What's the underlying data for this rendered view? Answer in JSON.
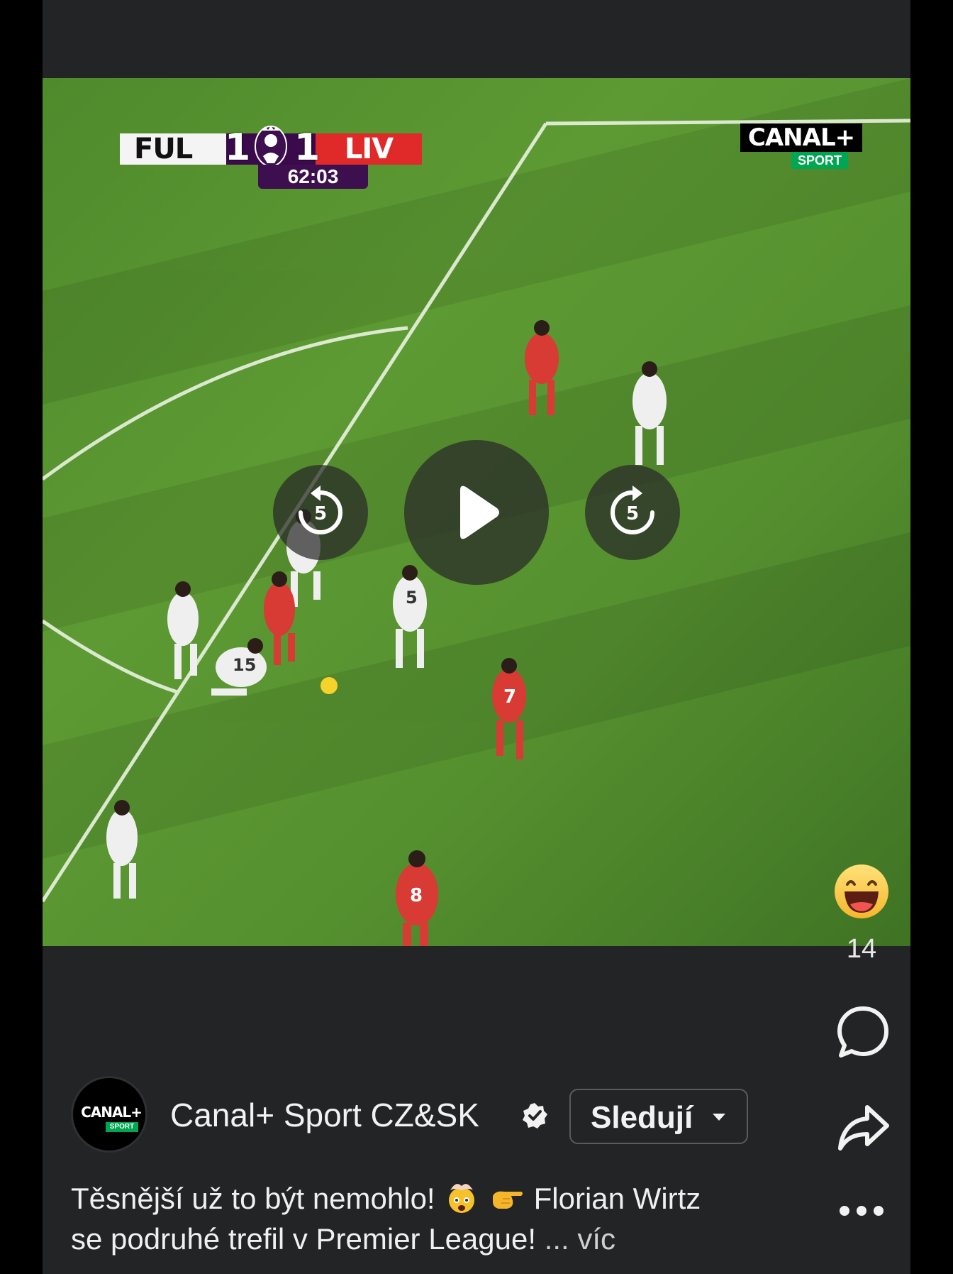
{
  "video": {
    "scoreboard": {
      "home_team": "FUL",
      "home_score": "1",
      "away_score": "1",
      "away_team": "LIV",
      "clock": "62:03"
    },
    "broadcaster": {
      "name": "CANAL+",
      "sub": "SPORT"
    },
    "controls": {
      "rewind_seconds": "5",
      "forward_seconds": "5"
    },
    "jersey_numbers": [
      "5",
      "15",
      "7",
      "8"
    ]
  },
  "reactions": {
    "count": "14"
  },
  "author": {
    "name": "Canal+ Sport CZ&SK",
    "avatar_line1": "CANAL+",
    "avatar_line2": "SPORT",
    "follow_label": "Sledují"
  },
  "caption": {
    "line1_a": "Těsnější už to být nemohlo!",
    "line1_b": "Florian Wirtz",
    "line2": "se podruhé trefil v Premier League!",
    "more": "... víc"
  },
  "colors": {
    "background": "#232426",
    "pitch": "#5d9a33",
    "home_color": "#f4f4f4",
    "away_color": "#e02929",
    "broadcaster_green": "#00a651"
  }
}
